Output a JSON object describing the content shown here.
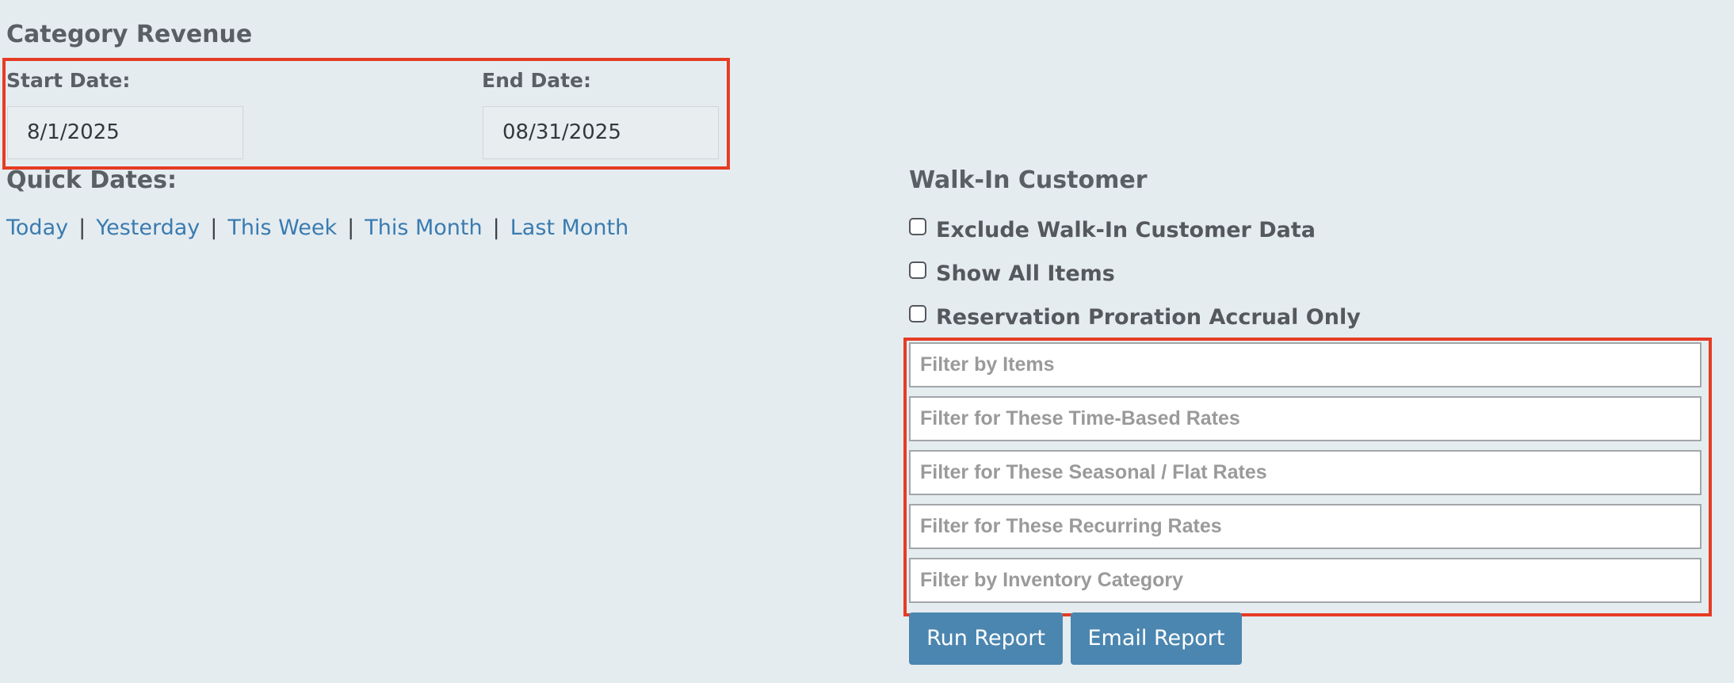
{
  "page": {
    "title": "Category Revenue"
  },
  "dates": {
    "start_label": "Start Date:",
    "start_value": "8/1/2025",
    "end_label": "End Date:",
    "end_value": "08/31/2025"
  },
  "quick_dates": {
    "title": "Quick Dates:",
    "separator": "|",
    "links": [
      "Today",
      "Yesterday",
      "This Week",
      "This Month",
      "Last Month"
    ]
  },
  "walk_in": {
    "title": "Walk-In Customer",
    "checkboxes": [
      {
        "label": "Exclude Walk-In Customer Data",
        "checked": false
      },
      {
        "label": "Show All Items",
        "checked": false
      },
      {
        "label": "Reservation Proration Accrual Only",
        "checked": false
      }
    ]
  },
  "filters": [
    {
      "placeholder": "Filter by Items"
    },
    {
      "placeholder": "Filter for These Time-Based Rates"
    },
    {
      "placeholder": "Filter for These Seasonal / Flat Rates"
    },
    {
      "placeholder": "Filter for These Recurring Rates"
    },
    {
      "placeholder": "Filter by Inventory Category"
    }
  ],
  "actions": {
    "run_label": "Run Report",
    "email_label": "Email Report"
  },
  "colors": {
    "background": "#e5ecf0",
    "link": "#3a7bb0",
    "button": "#4b86b0",
    "highlight": "#e53c24"
  }
}
